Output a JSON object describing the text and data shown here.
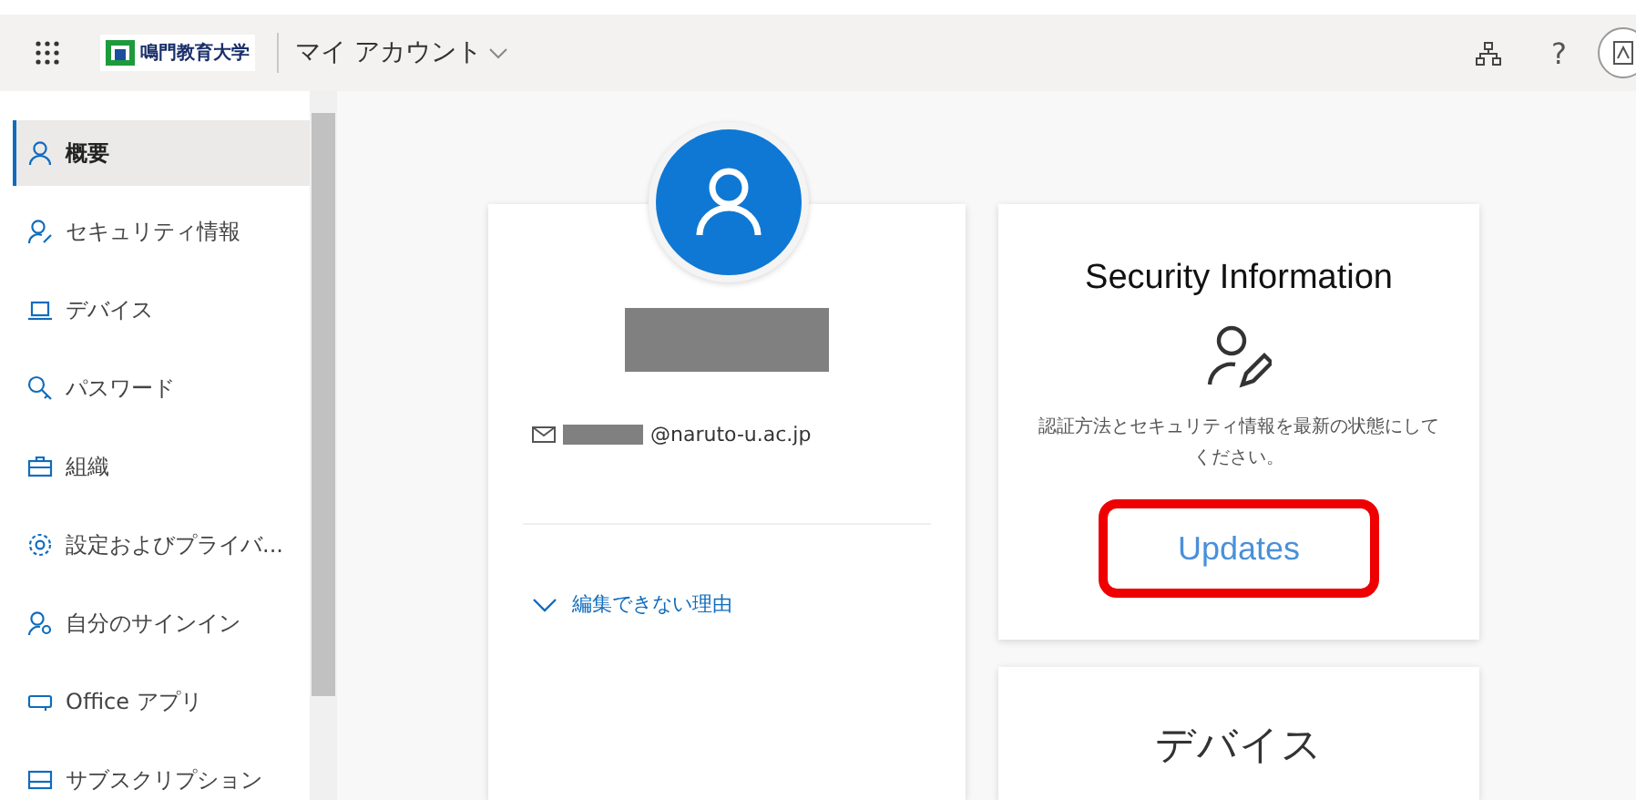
{
  "header": {
    "logo_text": "鳴門教育大学",
    "app_title": "マイ アカウント",
    "help": "?"
  },
  "sidebar": {
    "items": [
      {
        "label": "概要",
        "kind": "person",
        "selected": true
      },
      {
        "label": "セキュリティ情報",
        "kind": "person-edit",
        "selected": false
      },
      {
        "label": "デバイス",
        "kind": "laptop",
        "selected": false
      },
      {
        "label": "パスワード",
        "kind": "key",
        "selected": false
      },
      {
        "label": "組織",
        "kind": "briefcase",
        "selected": false
      },
      {
        "label": "設定およびプライバ...",
        "kind": "gear",
        "selected": false
      },
      {
        "label": "自分のサインイン",
        "kind": "person-key",
        "selected": false
      },
      {
        "label": "Office アプリ",
        "kind": "apps",
        "selected": false
      },
      {
        "label": "サブスクリプション",
        "kind": "card",
        "selected": false
      }
    ]
  },
  "profile": {
    "email_domain": "@naruto-u.ac.jp",
    "why_link": "編集できない理由"
  },
  "security_card": {
    "title": "Security Information",
    "description": "認証方法とセキュリティ情報を最新の状態にしてください。",
    "button": {
      "label": "Updates",
      "highlighted": true
    }
  },
  "devices_card": {
    "title": "デバイス"
  }
}
